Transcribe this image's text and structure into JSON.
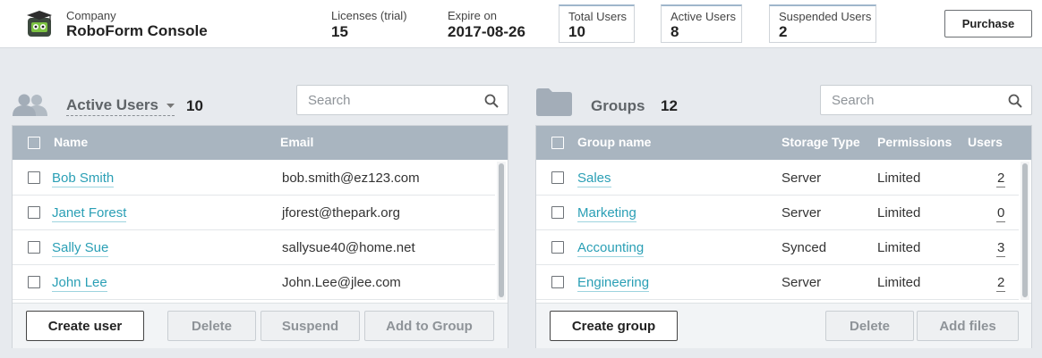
{
  "header": {
    "company_label": "Company",
    "company_name": "RoboForm Console",
    "licenses_label": "Licenses (trial)",
    "licenses_value": "15",
    "expire_label": "Expire on",
    "expire_value": "2017-08-26",
    "total_users_label": "Total Users",
    "total_users_value": "10",
    "active_users_label": "Active Users",
    "active_users_value": "8",
    "suspended_users_label": "Suspended Users",
    "suspended_users_value": "2",
    "purchase_label": "Purchase"
  },
  "users_panel": {
    "title": "Active Users",
    "count": "10",
    "search_placeholder": "Search",
    "columns": {
      "name": "Name",
      "email": "Email"
    },
    "rows": [
      {
        "name": "Bob Smith",
        "email": "bob.smith@ez123.com"
      },
      {
        "name": "Janet Forest",
        "email": "jforest@thepark.org"
      },
      {
        "name": "Sally Sue",
        "email": "sallysue40@home.net"
      },
      {
        "name": "John Lee",
        "email": "John.Lee@jlee.com"
      }
    ],
    "buttons": {
      "create": "Create user",
      "delete": "Delete",
      "suspend": "Suspend",
      "add_to_group": "Add to Group"
    }
  },
  "groups_panel": {
    "title": "Groups",
    "count": "12",
    "search_placeholder": "Search",
    "columns": {
      "name": "Group name",
      "storage": "Storage Type",
      "permissions": "Permissions",
      "users": "Users"
    },
    "rows": [
      {
        "name": "Sales",
        "storage": "Server",
        "permissions": "Limited",
        "users": "2"
      },
      {
        "name": "Marketing",
        "storage": "Server",
        "permissions": "Limited",
        "users": "0"
      },
      {
        "name": "Accounting",
        "storage": "Synced",
        "permissions": "Limited",
        "users": "3"
      },
      {
        "name": "Engineering",
        "storage": "Server",
        "permissions": "Limited",
        "users": "2"
      }
    ],
    "buttons": {
      "create": "Create group",
      "delete": "Delete",
      "add_files": "Add files"
    }
  },
  "icons": {
    "logo": "roboform-logo",
    "users": "users-icon",
    "folder": "folder-icon",
    "search": "search-icon",
    "dropdown": "caret-down-icon"
  },
  "colors": {
    "link": "#2a9fb5",
    "table_header": "#a9b5c0",
    "page_background": "#e7eaee"
  }
}
